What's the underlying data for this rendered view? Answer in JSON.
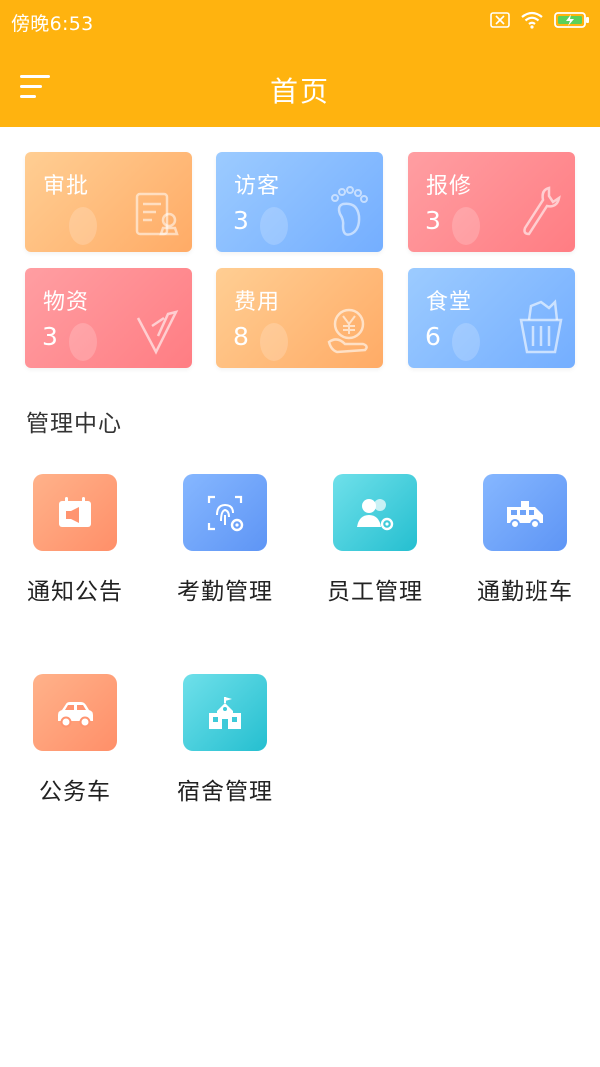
{
  "status_bar": {
    "time": "傍晚6:53",
    "icons": [
      "sim-blocked-icon",
      "wifi-icon",
      "battery-charging-icon"
    ]
  },
  "nav": {
    "title": "首页",
    "menu_icon": "hamburger-menu-icon"
  },
  "colors": {
    "header": "#FFB30F",
    "card_orange": "#FFB877",
    "card_blue": "#85BAFF",
    "card_red": "#FF868C",
    "tile_orange": "#FF9F78",
    "tile_blue": "#6FA3F8",
    "tile_teal": "#3ECAD9"
  },
  "cards": [
    {
      "title": "审批",
      "count": "",
      "icon": "approval-document-icon",
      "color": "orange"
    },
    {
      "title": "访客",
      "count": "3",
      "icon": "footprint-icon",
      "color": "blue"
    },
    {
      "title": "报修",
      "count": "3",
      "icon": "wrench-icon",
      "color": "red"
    },
    {
      "title": "物资",
      "count": "3",
      "icon": "supplies-icon",
      "color": "red"
    },
    {
      "title": "费用",
      "count": "8",
      "icon": "yuan-coin-icon",
      "color": "orange"
    },
    {
      "title": "食堂",
      "count": "6",
      "icon": "food-basket-icon",
      "color": "blue"
    }
  ],
  "section": {
    "title": "管理中心"
  },
  "grid": [
    {
      "label": "通知公告",
      "icon": "megaphone-calendar-icon",
      "color": "orange"
    },
    {
      "label": "考勤管理",
      "icon": "fingerprint-gear-icon",
      "color": "blue"
    },
    {
      "label": "员工管理",
      "icon": "people-gear-icon",
      "color": "teal"
    },
    {
      "label": "通勤班车",
      "icon": "shuttle-bus-icon",
      "color": "blue"
    },
    {
      "label": "公务车",
      "icon": "car-icon",
      "color": "orange"
    },
    {
      "label": "宿舍管理",
      "icon": "dormitory-building-icon",
      "color": "teal"
    }
  ]
}
